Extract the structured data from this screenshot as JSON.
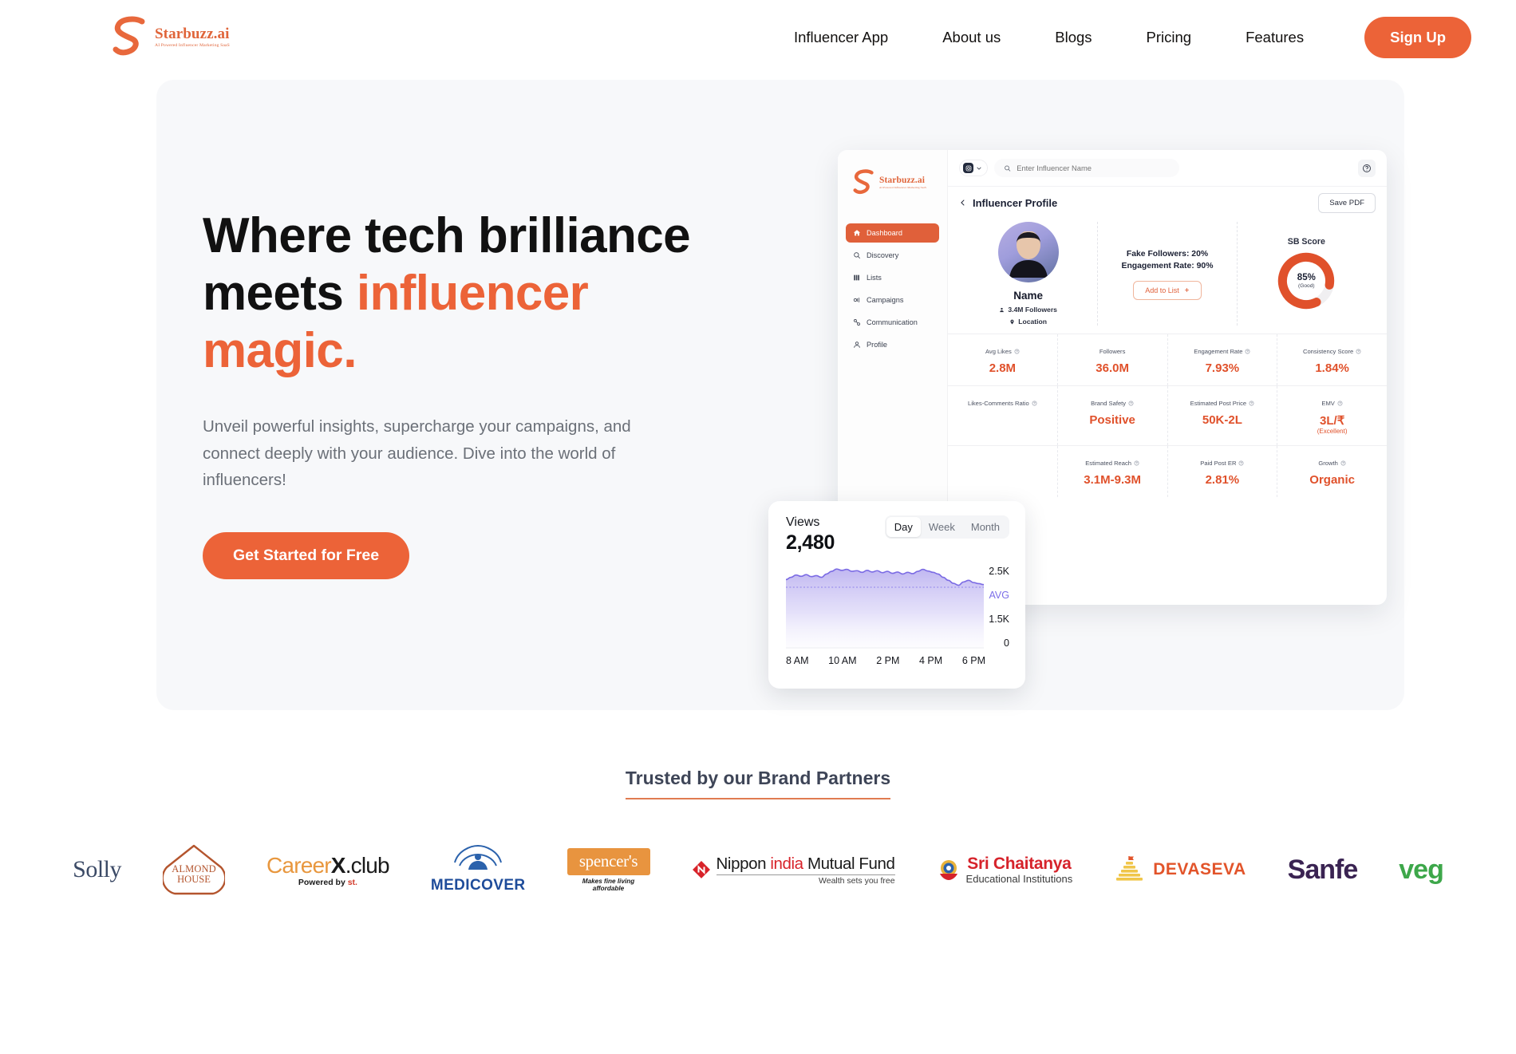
{
  "brand": {
    "name": "Starbuzz.ai",
    "tagline": "AI Powered Influencer Marketing SaaS",
    "accent": "#EC6338"
  },
  "header": {
    "nav": [
      {
        "label": "Influencer App"
      },
      {
        "label": "About us"
      },
      {
        "label": "Blogs"
      },
      {
        "label": "Pricing"
      },
      {
        "label": "Features"
      }
    ],
    "signup_label": "Sign Up"
  },
  "hero": {
    "heading_line1": "Where tech brilliance",
    "heading_line2_plain": "meets ",
    "heading_line2_accent": "influencer",
    "heading_line3_accent": "magic.",
    "subtitle": "Unveil powerful insights, supercharge your campaigns, and connect deeply with your audience. Dive into the world of influencers!",
    "cta_label": "Get Started for Free"
  },
  "mock": {
    "sidebar": [
      {
        "label": "Dashboard",
        "icon": "home-icon",
        "active": true
      },
      {
        "label": "Discovery",
        "icon": "search-icon",
        "active": false
      },
      {
        "label": "Lists",
        "icon": "list-icon",
        "active": false
      },
      {
        "label": "Campaigns",
        "icon": "megaphone-icon",
        "active": false
      },
      {
        "label": "Communication",
        "icon": "link-icon",
        "active": false
      },
      {
        "label": "Profile",
        "icon": "user-icon",
        "active": false
      }
    ],
    "search_placeholder": "Enter Influencer Name",
    "page_title": "Influencer Profile",
    "save_pdf_label": "Save PDF",
    "profile": {
      "name": "Name",
      "followers": "3.4M Followers",
      "location": "Location",
      "fake_followers": "Fake Followers: 20%",
      "engagement_rate": "Engagement Rate: 90%",
      "add_to_list_label": "Add to List"
    },
    "sb_score": {
      "title": "SB Score",
      "value": "85%",
      "rating": "(Good)",
      "percent": 85,
      "color": "#E0512B"
    },
    "metrics": [
      [
        {
          "label": "Avg Likes",
          "value": "2.8M",
          "info": true
        },
        {
          "label": "Followers",
          "value": "36.0M",
          "info": false
        },
        {
          "label": "Engagement Rate",
          "value": "7.93%",
          "info": true
        },
        {
          "label": "Consistency Score",
          "value": "1.84%",
          "info": true
        }
      ],
      [
        {
          "label": "Likes-Comments Ratio",
          "value": "",
          "info": true
        },
        {
          "label": "Brand Safety",
          "value": "Positive",
          "info": true
        },
        {
          "label": "Estimated Post Price",
          "value": "50K-2L",
          "info": true
        },
        {
          "label": "EMV",
          "value": "3L/₹",
          "sub": "(Excellent)",
          "info": true
        }
      ],
      [
        {
          "label": "",
          "value": "",
          "info": false
        },
        {
          "label": "Estimated Reach",
          "value": "3.1M-9.3M",
          "info": true
        },
        {
          "label": "Paid Post ER",
          "value": "2.81%",
          "info": true
        },
        {
          "label": "Growth",
          "value": "Organic",
          "info": true
        }
      ]
    ]
  },
  "views_card": {
    "label": "Views",
    "value": "2,480",
    "segments": [
      {
        "label": "Day",
        "active": true
      },
      {
        "label": "Week",
        "active": false
      },
      {
        "label": "Month",
        "active": false
      }
    ],
    "chart_data": {
      "type": "area",
      "title": "Views",
      "xlabel": "",
      "ylabel": "",
      "ylim": [
        0,
        2500
      ],
      "grid": false,
      "legend": "none",
      "yticks": [
        "2.5K",
        "AVG",
        "1.5K",
        "0"
      ],
      "avg_line": 1850,
      "avg_color": "#7C6EE8",
      "line_color": "#7B6BE4",
      "fill_color": "#C6BFF4",
      "xticks": [
        "8 AM",
        "10 AM",
        "2 PM",
        "4 PM",
        "6 PM"
      ],
      "x": [
        0,
        1,
        2,
        3,
        4,
        5,
        6,
        7,
        8,
        9,
        10,
        11,
        12,
        13,
        14,
        15,
        16,
        17,
        18,
        19,
        20,
        21,
        22,
        23,
        24,
        25,
        26,
        27,
        28,
        29,
        30,
        31,
        32,
        33,
        34,
        35,
        36,
        37,
        38,
        39
      ],
      "values": [
        2080,
        2150,
        2220,
        2180,
        2230,
        2170,
        2200,
        2150,
        2250,
        2330,
        2400,
        2360,
        2390,
        2330,
        2350,
        2300,
        2360,
        2310,
        2350,
        2290,
        2330,
        2270,
        2310,
        2250,
        2300,
        2260,
        2330,
        2390,
        2340,
        2300,
        2250,
        2150,
        2060,
        1970,
        1910,
        2010,
        2060,
        1990,
        1960,
        1930
      ]
    }
  },
  "partners": {
    "title": "Trusted by our Brand Partners",
    "underline_color": "#E07B50",
    "logos": [
      {
        "name": "Solly",
        "id": "solly"
      },
      {
        "name": "ALMOND HOUSE",
        "id": "almond-house",
        "line1": "ALMOND",
        "line2": "HOUSE"
      },
      {
        "name": "CareerX.club",
        "id": "careerx",
        "part1": "Career",
        "part2": "X",
        "part3": ".club",
        "sub_plain": "Powered by ",
        "sub_accent": "st."
      },
      {
        "name": "MEDICOVER",
        "id": "medicover"
      },
      {
        "name": "spencer's",
        "id": "spencers",
        "sub": "Makes fine living affordable"
      },
      {
        "name": "Nippon India Mutual Fund",
        "id": "nippon",
        "p1": "Nippon ",
        "p2": "india",
        "p3": " Mutual Fund",
        "sub": "Wealth sets you free"
      },
      {
        "name": "Sri Chaitanya Educational Institutions",
        "id": "sri-chaitanya",
        "line1": "Sri Chaitanya",
        "line2": "Educational Institutions"
      },
      {
        "name": "DEVASEVA",
        "id": "devaseva"
      },
      {
        "name": "Sanfe",
        "id": "sanfe"
      },
      {
        "name": "veg",
        "id": "veg"
      }
    ]
  }
}
